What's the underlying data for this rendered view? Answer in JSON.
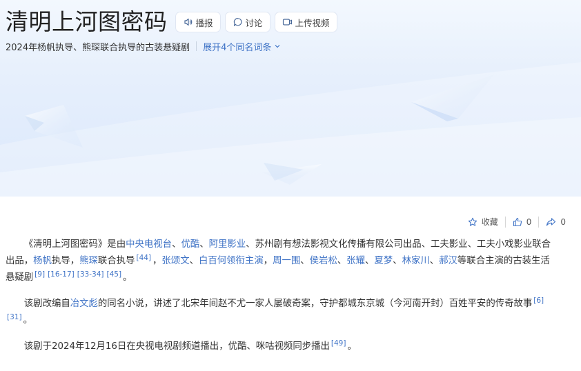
{
  "page": {
    "title": "清明上河图密码",
    "buttons": [
      {
        "label": "播报",
        "icon": "speaker-icon"
      },
      {
        "label": "讨论",
        "icon": "chat-bubble-icon"
      },
      {
        "label": "上传视频",
        "icon": "video-upload-icon"
      }
    ],
    "subtitle": "2024年杨帆执导、熊琛联合执导的古装悬疑剧",
    "expand_label": "展开4个同名词条"
  },
  "actions": {
    "favorite_label": "收藏",
    "like_count": "0",
    "share_count": "0"
  },
  "paragraphs": [
    [
      {
        "t": "《清明上河图密码》是由"
      },
      {
        "t": "中央电视台",
        "link": true
      },
      {
        "t": "、"
      },
      {
        "t": "优酷",
        "link": true
      },
      {
        "t": "、"
      },
      {
        "t": "阿里影业",
        "link": true
      },
      {
        "t": "、苏州剧有想法影视文化传播有限公司出品、工夫影业、工夫小戏影业联合出品，"
      },
      {
        "t": "杨帆",
        "link": true
      },
      {
        "t": "执导，"
      },
      {
        "t": "熊琛",
        "link": true
      },
      {
        "t": "联合执导"
      },
      {
        "ref": "[44]"
      },
      {
        "t": "，"
      },
      {
        "t": "张颂文",
        "link": true
      },
      {
        "t": "、"
      },
      {
        "t": "白百何",
        "link": true
      },
      {
        "t": "领衔主演",
        "link": true
      },
      {
        "t": "，"
      },
      {
        "t": "周一围",
        "link": true
      },
      {
        "t": "、"
      },
      {
        "t": "侯岩松",
        "link": true
      },
      {
        "t": "、"
      },
      {
        "t": "张耀",
        "link": true
      },
      {
        "t": "、"
      },
      {
        "t": "夏梦",
        "link": true
      },
      {
        "t": "、"
      },
      {
        "t": "林家川",
        "link": true
      },
      {
        "t": "、"
      },
      {
        "t": "郝汉",
        "link": true
      },
      {
        "t": "等联合主演的古装生活悬疑剧"
      },
      {
        "ref": "[9]"
      },
      {
        "ref": "[16-17]"
      },
      {
        "ref": "[33-34]"
      },
      {
        "ref": "[45]"
      },
      {
        "t": "。"
      }
    ],
    [
      {
        "t": "该剧改编自"
      },
      {
        "t": "冶文彪",
        "link": true
      },
      {
        "t": "的同名小说，讲述了北宋年间赵不尤一家人屡破奇案，守护都城东京城（今河南开封）百姓平安的传奇故事"
      },
      {
        "ref": "[6]"
      },
      {
        "ref": "[31]"
      },
      {
        "t": "。"
      }
    ],
    [
      {
        "t": "该剧于2024年12月16日在央视电视剧频道播出，优酷、咪咕视频同步播出"
      },
      {
        "ref": "[49]"
      },
      {
        "t": "。"
      }
    ]
  ],
  "colors": {
    "link": "#3f73c6",
    "hero_light": "#f3f8fe",
    "hero_dark": "#dbe8fb"
  }
}
